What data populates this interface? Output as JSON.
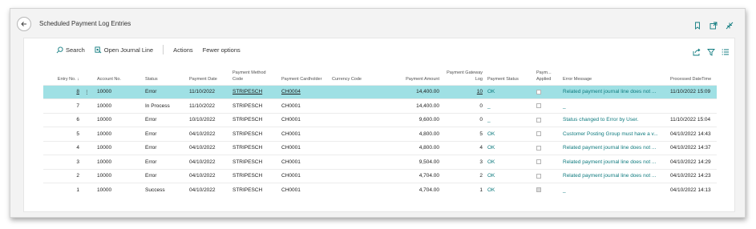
{
  "page": {
    "title": "Scheduled Payment Log Entries"
  },
  "toolbar": {
    "search_label": "Search",
    "open_journal_label": "Open Journal Line",
    "actions_label": "Actions",
    "fewer_options_label": "Fewer options"
  },
  "columns": {
    "entry_no": "Entry No. ↓",
    "account_no": "Account No.",
    "status": "Status",
    "payment_date": "Payment Date",
    "payment_method_code": "Payment Method Code",
    "payment_cardholder": "Payment Cardholder",
    "currency_code": "Currency Code",
    "payment_amount": "Payment Amount",
    "payment_gateway_log": "Payment Gateway Log",
    "payment_status": "Payment Status",
    "payment_applied": "Paym... Applied",
    "error_message": "Error Message",
    "processed_datetime": "Processed DateTime"
  },
  "rows": [
    {
      "entry_no": "8",
      "account_no": "10000",
      "status": "Error",
      "payment_date": "11/10/2022",
      "method": "STRIPESCH",
      "cardholder": "CH0004",
      "currency": "",
      "amount": "14,400.00",
      "gateway_log": "10",
      "payment_status": "OK",
      "applied": false,
      "error_message": "Related payment journal line does not ...",
      "processed": "11/10/2022 15:09"
    },
    {
      "entry_no": "7",
      "account_no": "10000",
      "status": "In Process",
      "payment_date": "11/10/2022",
      "method": "STRIPESCH",
      "cardholder": "CH0001",
      "currency": "",
      "amount": "14,400.00",
      "gateway_log": "0",
      "payment_status": "_",
      "applied": false,
      "error_message": "_",
      "processed": ""
    },
    {
      "entry_no": "6",
      "account_no": "10000",
      "status": "Error",
      "payment_date": "10/10/2022",
      "method": "STRIPESCH",
      "cardholder": "CH0001",
      "currency": "",
      "amount": "9,600.00",
      "gateway_log": "0",
      "payment_status": "_",
      "applied": false,
      "error_message": "Status changed to Error by User.",
      "processed": "11/10/2022 15:04"
    },
    {
      "entry_no": "5",
      "account_no": "10000",
      "status": "Error",
      "payment_date": "04/10/2022",
      "method": "STRIPESCH",
      "cardholder": "CH0001",
      "currency": "",
      "amount": "4,800.00",
      "gateway_log": "5",
      "payment_status": "OK",
      "applied": false,
      "error_message": "Customer Posting Group must have a v...",
      "processed": "04/10/2022 14:43"
    },
    {
      "entry_no": "4",
      "account_no": "10000",
      "status": "Error",
      "payment_date": "04/10/2022",
      "method": "STRIPESCH",
      "cardholder": "CH0001",
      "currency": "",
      "amount": "4,800.00",
      "gateway_log": "4",
      "payment_status": "OK",
      "applied": false,
      "error_message": "Related payment journal line does not ...",
      "processed": "04/10/2022 14:37"
    },
    {
      "entry_no": "3",
      "account_no": "10000",
      "status": "Error",
      "payment_date": "04/10/2022",
      "method": "STRIPESCH",
      "cardholder": "CH0001",
      "currency": "",
      "amount": "9,504.00",
      "gateway_log": "3",
      "payment_status": "OK",
      "applied": false,
      "error_message": "Related payment journal line does not ...",
      "processed": "04/10/2022 14:29"
    },
    {
      "entry_no": "2",
      "account_no": "10000",
      "status": "Error",
      "payment_date": "04/10/2022",
      "method": "STRIPESCH",
      "cardholder": "CH0001",
      "currency": "",
      "amount": "4,704.00",
      "gateway_log": "2",
      "payment_status": "OK",
      "applied": false,
      "error_message": "Related payment journal line does not ...",
      "processed": "04/10/2022 14:23"
    },
    {
      "entry_no": "1",
      "account_no": "10000",
      "status": "Success",
      "payment_date": "04/10/2022",
      "method": "STRIPESCH",
      "cardholder": "CH0001",
      "currency": "",
      "amount": "4,704.00",
      "gateway_log": "1",
      "payment_status": "OK",
      "applied": true,
      "error_message": "_",
      "processed": "04/10/2022 14:13"
    }
  ],
  "colors": {
    "accent": "#0f7b7f",
    "selected_row": "#9fe0e4"
  }
}
